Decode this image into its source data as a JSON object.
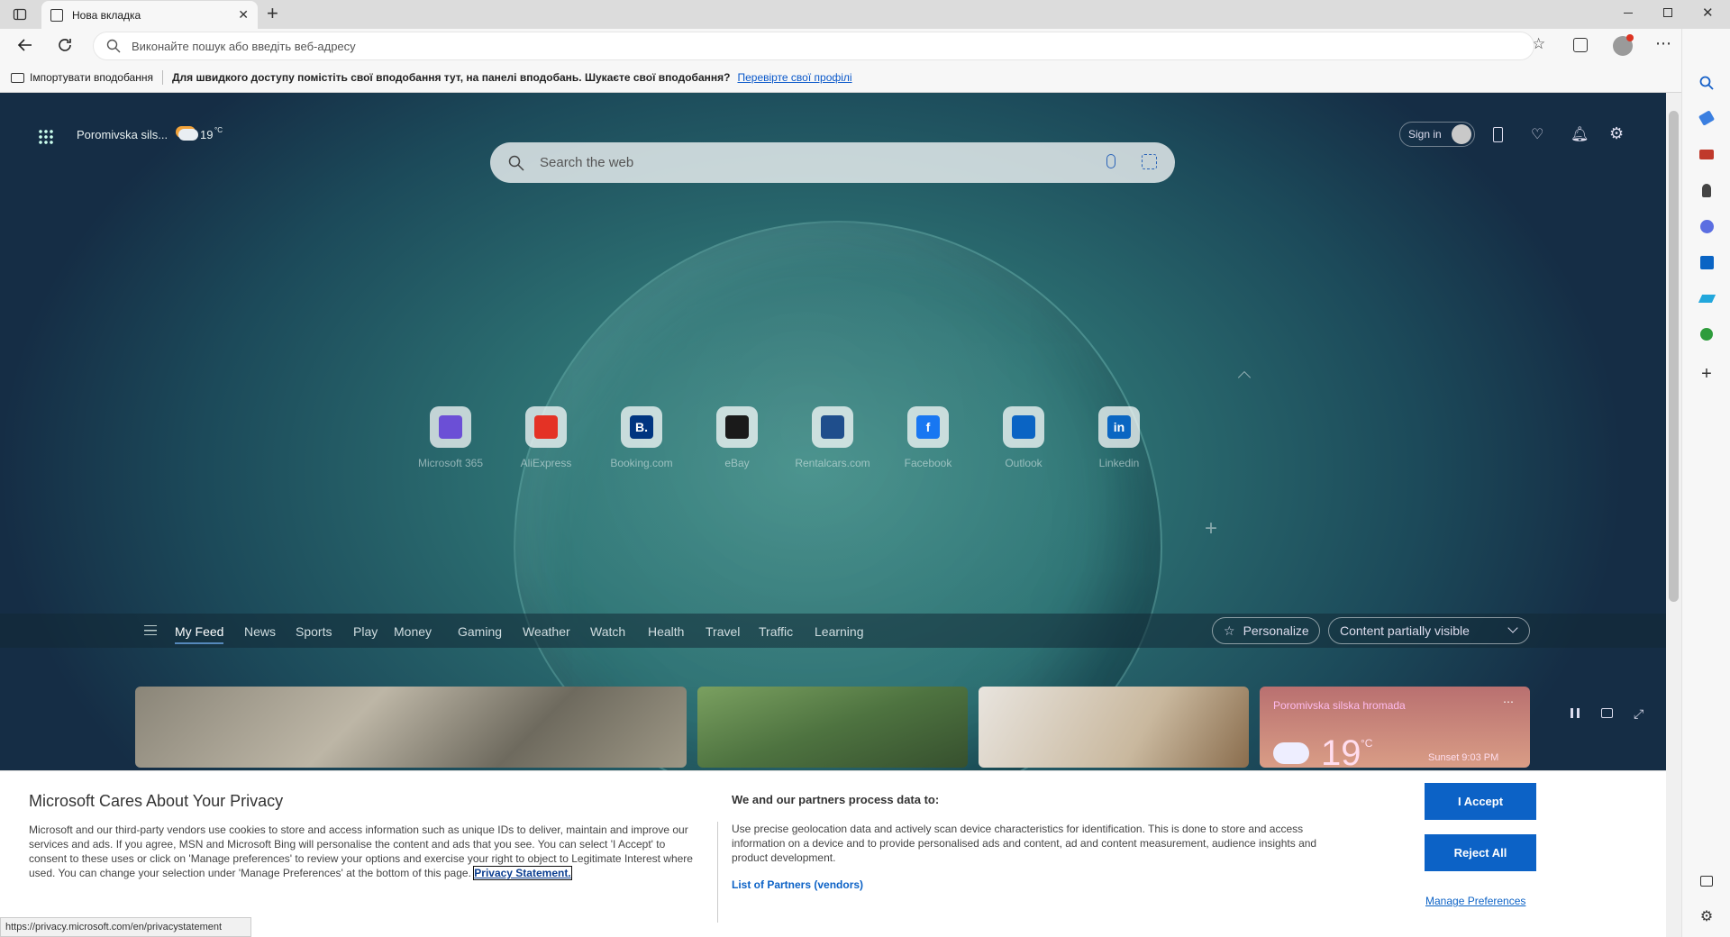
{
  "tab": {
    "title": "Нова вкладка"
  },
  "address": {
    "placeholder": "Виконайте пошук або введіть веб-адресу"
  },
  "favbar": {
    "import_label": "Імпортувати вподобання",
    "message": "Для швидкого доступу помістіть свої вподобання тут, на панелі вподобань. Шукаєте свої вподобання?",
    "link": "Перевірте свої профілі"
  },
  "ntp": {
    "location": "Poromivska sils...",
    "temp": "19",
    "temp_unit": "°C",
    "sign_in": "Sign in",
    "search_placeholder": "Search the web",
    "tiles": [
      {
        "label": "Microsoft 365",
        "icon": "microsoft365-icon",
        "color": "#6b4fd6"
      },
      {
        "label": "AliExpress",
        "icon": "aliexpress-icon",
        "color": "#e43225"
      },
      {
        "label": "Booking.com",
        "icon": "booking-icon",
        "color": "#003580",
        "glyph": "B."
      },
      {
        "label": "eBay",
        "icon": "ebay-icon",
        "color": "#1a1a1a"
      },
      {
        "label": "Rentalcars.com",
        "icon": "rentalcars-icon",
        "color": "#1f4e8c"
      },
      {
        "label": "Facebook",
        "icon": "facebook-icon",
        "color": "#1877f2",
        "glyph": "f"
      },
      {
        "label": "Outlook",
        "icon": "outlook-icon",
        "color": "#0a64c4"
      },
      {
        "label": "Linkedin",
        "icon": "linkedin-icon",
        "color": "#0a66c2",
        "glyph": "in"
      }
    ],
    "feed_tabs": [
      "My Feed",
      "News",
      "Sports",
      "Play",
      "Money",
      "Gaming",
      "Weather",
      "Watch",
      "Health",
      "Travel",
      "Traffic",
      "Learning"
    ],
    "personalize": "Personalize",
    "content_visibility": "Content partially visible",
    "weather_card": {
      "location": "Poromivska silska hromada",
      "temp": "19",
      "unit": "°C",
      "sunset": "Sunset 9:03 PM"
    }
  },
  "consent": {
    "title": "Microsoft Cares About Your Privacy",
    "body": "Microsoft and our third-party vendors use cookies to store and access information such as unique IDs to deliver, maintain and improve our services and ads. If you agree, MSN and Microsoft Bing will personalise the content and ads that you see. You can select 'I Accept' to consent to these uses or click on 'Manage preferences' to review your options and exercise your right to object to Legitimate Interest where used.  You can change your selection under 'Manage Preferences' at the bottom of this page.",
    "privacy_link": "Privacy Statement.",
    "partners_title": "We and our partners process data to:",
    "partners_body": "Use precise geolocation data and actively scan device characteristics for identification. This is done to store and access information on a device and to provide personalised ads and content, ad and content measurement, audience insights and product development.",
    "partners_link": "List of Partners (vendors)",
    "accept": "I Accept",
    "reject": "Reject All",
    "manage": "Manage Preferences"
  },
  "status_url": "https://privacy.microsoft.com/en/privacystatement"
}
